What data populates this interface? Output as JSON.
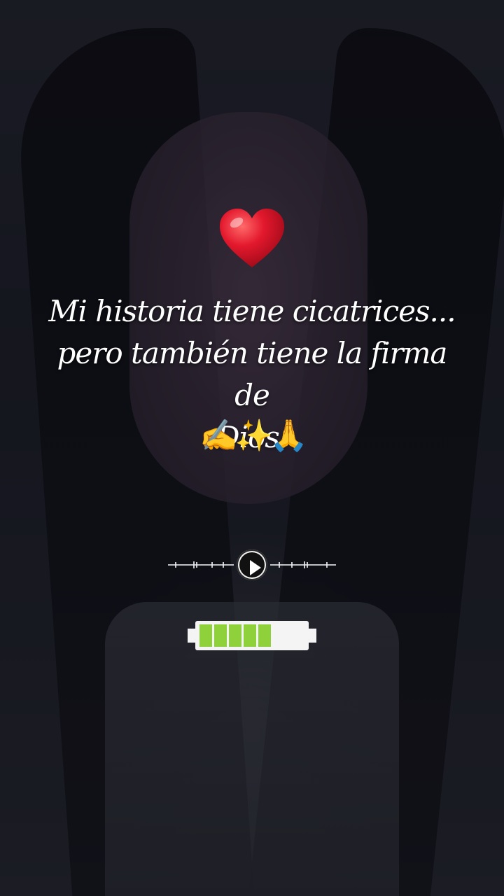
{
  "post": {
    "quote_lines": [
      "Mi historia tiene cicatrices...",
      "pero también tiene la firma de",
      "Dios."
    ],
    "emojis": [
      "✍️",
      "✨",
      "🙏"
    ]
  },
  "icons": {
    "heart": "red-heart-icon",
    "play": "play-icon",
    "battery": "battery-icon"
  },
  "audio_player": {
    "state": "paused"
  },
  "battery": {
    "filled_cells": 5,
    "total_cells": 8,
    "level": 0.62
  },
  "colors": {
    "heart": "#e3182d",
    "battery_fill": "#8fd13a",
    "text": "#ffffff"
  }
}
